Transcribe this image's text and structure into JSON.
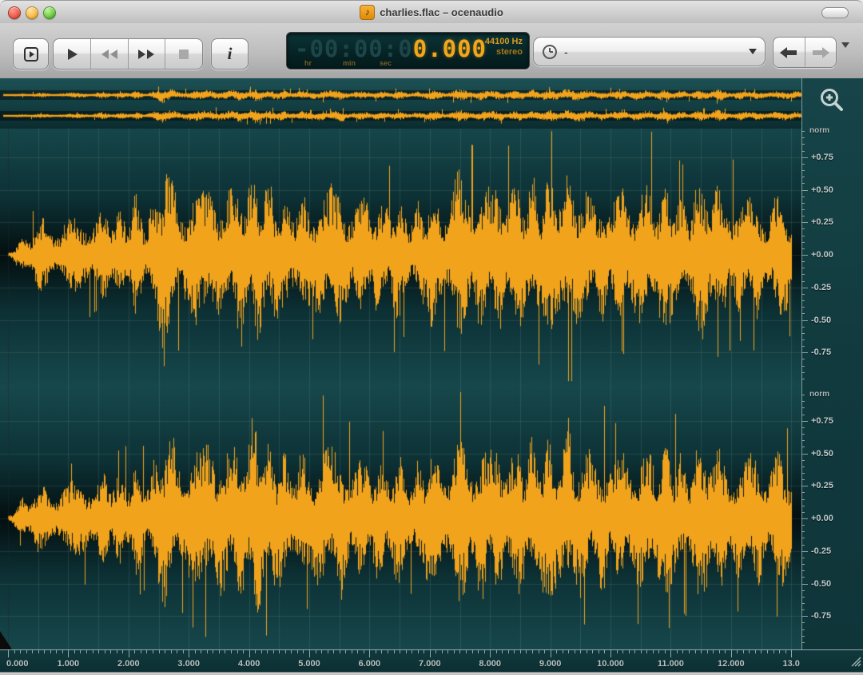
{
  "window": {
    "title": "charlies.flac – ocenaudio"
  },
  "toolbar": {
    "buttons": {
      "preview_play": "play-boxed",
      "play": "play",
      "rewind": "rewind",
      "fast_forward": "fast-forward",
      "stop": "stop",
      "info_label": "i"
    },
    "time_display": {
      "dim_digits": "-00:00:0",
      "current": "0.000",
      "unit_hr": "hr",
      "unit_min": "min",
      "unit_sec": "sec",
      "sample_rate": "44100 Hz",
      "channel_mode": "stereo"
    },
    "selector": {
      "value": "-"
    }
  },
  "ruler": {
    "norm_label": "norm",
    "labels": [
      "+0.75",
      "+0.50",
      "+0.25",
      "+0.00",
      "-0.25",
      "-0.50",
      "-0.75"
    ],
    "major_step": 0.25,
    "minor_step": 0.05
  },
  "time_axis": {
    "labels": [
      "0.000",
      "1.000",
      "2.000",
      "3.000",
      "4.000",
      "5.000",
      "6.000",
      "7.000",
      "8.000",
      "9.000",
      "10.000",
      "11.000",
      "12.000",
      "13.0"
    ],
    "start_sec": 0,
    "end_sec": 13.0,
    "major_step_sec": 1.0,
    "minor_step_sec": 0.1
  },
  "waveform": {
    "duration_sec": 13.0,
    "color": "#f2a31c",
    "grid_color": "rgba(150,185,185,0.15)",
    "bg_outer": "#17484c",
    "bg_mid": "#0d3236",
    "bg_center": "#040f10",
    "channels": [
      {
        "name": "left",
        "envelope": [
          0.02,
          0.06,
          0.12,
          0.18,
          0.22,
          0.26,
          0.28,
          0.24,
          0.26,
          0.3,
          0.32,
          0.28,
          0.26,
          0.34,
          0.3,
          0.28,
          0.38,
          0.44,
          0.34,
          0.3,
          0.44,
          0.5,
          0.4,
          0.34,
          0.4,
          0.55,
          0.95,
          0.72,
          0.5,
          0.46,
          0.5,
          0.56,
          0.46,
          0.6,
          0.7,
          0.56,
          0.5,
          0.56,
          0.64,
          0.7,
          0.6,
          0.74,
          0.66,
          0.56,
          0.6,
          0.5,
          0.46,
          0.5,
          0.56,
          0.46,
          0.4,
          0.46,
          0.56,
          0.5,
          0.56,
          0.6,
          0.5,
          0.46,
          0.4,
          0.46,
          0.5,
          0.46,
          0.4,
          0.44,
          0.5,
          0.46,
          0.4,
          0.36,
          0.4,
          0.46,
          0.54,
          0.5,
          0.46,
          0.54,
          0.6,
          0.64,
          0.6,
          0.56,
          0.6,
          0.56,
          0.5,
          0.56,
          0.6,
          0.56,
          0.5,
          0.56,
          0.6,
          0.66,
          0.56,
          0.6,
          0.64,
          0.6,
          0.7,
          0.86,
          0.64,
          0.56,
          0.5,
          0.46,
          0.5,
          0.56,
          0.5,
          0.46,
          0.5,
          0.56,
          0.5,
          0.54,
          0.6,
          0.64,
          0.56,
          0.5,
          0.56,
          0.5,
          0.46,
          0.5,
          0.54,
          0.6,
          0.74,
          0.6,
          0.5,
          0.46,
          0.5,
          0.46,
          0.42,
          0.46,
          0.5,
          0.46,
          0.42,
          0.46,
          0.5,
          0.46,
          0.4
        ]
      },
      {
        "name": "right",
        "envelope": [
          0.03,
          0.07,
          0.14,
          0.2,
          0.24,
          0.26,
          0.24,
          0.22,
          0.26,
          0.32,
          0.3,
          0.26,
          0.28,
          0.36,
          0.32,
          0.3,
          0.4,
          0.42,
          0.36,
          0.32,
          0.42,
          0.46,
          0.38,
          0.36,
          0.42,
          0.52,
          0.8,
          0.66,
          0.52,
          0.48,
          0.52,
          0.58,
          0.5,
          0.64,
          0.78,
          0.6,
          0.54,
          0.6,
          0.68,
          0.64,
          0.66,
          0.92,
          0.7,
          0.58,
          0.62,
          0.52,
          0.48,
          0.52,
          0.58,
          0.5,
          0.44,
          0.5,
          0.66,
          0.54,
          0.58,
          0.62,
          0.52,
          0.48,
          0.42,
          0.48,
          0.52,
          0.48,
          0.44,
          0.48,
          0.52,
          0.48,
          0.42,
          0.38,
          0.44,
          0.5,
          0.58,
          0.52,
          0.48,
          0.56,
          0.62,
          0.66,
          0.62,
          0.58,
          0.64,
          0.7,
          0.54,
          0.58,
          0.62,
          0.58,
          0.52,
          0.58,
          0.62,
          0.68,
          0.58,
          0.62,
          0.66,
          0.62,
          0.74,
          0.8,
          0.62,
          0.58,
          0.52,
          0.48,
          0.52,
          0.58,
          0.52,
          0.48,
          0.52,
          0.58,
          0.52,
          0.56,
          0.62,
          0.66,
          0.58,
          0.52,
          0.58,
          0.52,
          0.48,
          0.52,
          0.56,
          0.62,
          0.7,
          0.62,
          0.52,
          0.48,
          0.52,
          0.48,
          0.44,
          0.48,
          0.52,
          0.48,
          0.44,
          0.48,
          0.52,
          0.48,
          0.42
        ]
      }
    ]
  }
}
